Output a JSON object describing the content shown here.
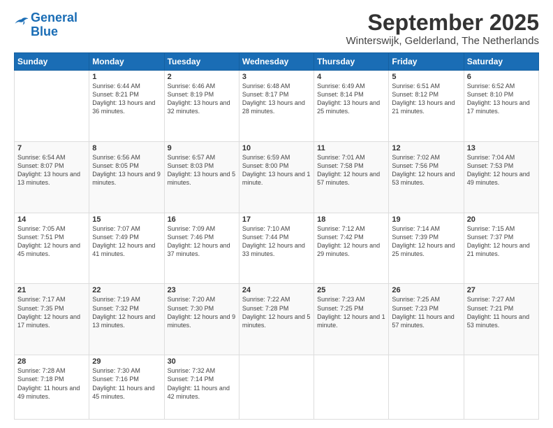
{
  "logo": {
    "line1": "General",
    "line2": "Blue"
  },
  "header": {
    "month": "September 2025",
    "location": "Winterswijk, Gelderland, The Netherlands"
  },
  "weekdays": [
    "Sunday",
    "Monday",
    "Tuesday",
    "Wednesday",
    "Thursday",
    "Friday",
    "Saturday"
  ],
  "weeks": [
    [
      {
        "day": "",
        "sunrise": "",
        "sunset": "",
        "daylight": ""
      },
      {
        "day": "1",
        "sunrise": "6:44 AM",
        "sunset": "8:21 PM",
        "daylight": "13 hours and 36 minutes."
      },
      {
        "day": "2",
        "sunrise": "6:46 AM",
        "sunset": "8:19 PM",
        "daylight": "13 hours and 32 minutes."
      },
      {
        "day": "3",
        "sunrise": "6:48 AM",
        "sunset": "8:17 PM",
        "daylight": "13 hours and 28 minutes."
      },
      {
        "day": "4",
        "sunrise": "6:49 AM",
        "sunset": "8:14 PM",
        "daylight": "13 hours and 25 minutes."
      },
      {
        "day": "5",
        "sunrise": "6:51 AM",
        "sunset": "8:12 PM",
        "daylight": "13 hours and 21 minutes."
      },
      {
        "day": "6",
        "sunrise": "6:52 AM",
        "sunset": "8:10 PM",
        "daylight": "13 hours and 17 minutes."
      }
    ],
    [
      {
        "day": "7",
        "sunrise": "6:54 AM",
        "sunset": "8:07 PM",
        "daylight": "13 hours and 13 minutes."
      },
      {
        "day": "8",
        "sunrise": "6:56 AM",
        "sunset": "8:05 PM",
        "daylight": "13 hours and 9 minutes."
      },
      {
        "day": "9",
        "sunrise": "6:57 AM",
        "sunset": "8:03 PM",
        "daylight": "13 hours and 5 minutes."
      },
      {
        "day": "10",
        "sunrise": "6:59 AM",
        "sunset": "8:00 PM",
        "daylight": "13 hours and 1 minute."
      },
      {
        "day": "11",
        "sunrise": "7:01 AM",
        "sunset": "7:58 PM",
        "daylight": "12 hours and 57 minutes."
      },
      {
        "day": "12",
        "sunrise": "7:02 AM",
        "sunset": "7:56 PM",
        "daylight": "12 hours and 53 minutes."
      },
      {
        "day": "13",
        "sunrise": "7:04 AM",
        "sunset": "7:53 PM",
        "daylight": "12 hours and 49 minutes."
      }
    ],
    [
      {
        "day": "14",
        "sunrise": "7:05 AM",
        "sunset": "7:51 PM",
        "daylight": "12 hours and 45 minutes."
      },
      {
        "day": "15",
        "sunrise": "7:07 AM",
        "sunset": "7:49 PM",
        "daylight": "12 hours and 41 minutes."
      },
      {
        "day": "16",
        "sunrise": "7:09 AM",
        "sunset": "7:46 PM",
        "daylight": "12 hours and 37 minutes."
      },
      {
        "day": "17",
        "sunrise": "7:10 AM",
        "sunset": "7:44 PM",
        "daylight": "12 hours and 33 minutes."
      },
      {
        "day": "18",
        "sunrise": "7:12 AM",
        "sunset": "7:42 PM",
        "daylight": "12 hours and 29 minutes."
      },
      {
        "day": "19",
        "sunrise": "7:14 AM",
        "sunset": "7:39 PM",
        "daylight": "12 hours and 25 minutes."
      },
      {
        "day": "20",
        "sunrise": "7:15 AM",
        "sunset": "7:37 PM",
        "daylight": "12 hours and 21 minutes."
      }
    ],
    [
      {
        "day": "21",
        "sunrise": "7:17 AM",
        "sunset": "7:35 PM",
        "daylight": "12 hours and 17 minutes."
      },
      {
        "day": "22",
        "sunrise": "7:19 AM",
        "sunset": "7:32 PM",
        "daylight": "12 hours and 13 minutes."
      },
      {
        "day": "23",
        "sunrise": "7:20 AM",
        "sunset": "7:30 PM",
        "daylight": "12 hours and 9 minutes."
      },
      {
        "day": "24",
        "sunrise": "7:22 AM",
        "sunset": "7:28 PM",
        "daylight": "12 hours and 5 minutes."
      },
      {
        "day": "25",
        "sunrise": "7:23 AM",
        "sunset": "7:25 PM",
        "daylight": "12 hours and 1 minute."
      },
      {
        "day": "26",
        "sunrise": "7:25 AM",
        "sunset": "7:23 PM",
        "daylight": "11 hours and 57 minutes."
      },
      {
        "day": "27",
        "sunrise": "7:27 AM",
        "sunset": "7:21 PM",
        "daylight": "11 hours and 53 minutes."
      }
    ],
    [
      {
        "day": "28",
        "sunrise": "7:28 AM",
        "sunset": "7:18 PM",
        "daylight": "11 hours and 49 minutes."
      },
      {
        "day": "29",
        "sunrise": "7:30 AM",
        "sunset": "7:16 PM",
        "daylight": "11 hours and 45 minutes."
      },
      {
        "day": "30",
        "sunrise": "7:32 AM",
        "sunset": "7:14 PM",
        "daylight": "11 hours and 42 minutes."
      },
      {
        "day": "",
        "sunrise": "",
        "sunset": "",
        "daylight": ""
      },
      {
        "day": "",
        "sunrise": "",
        "sunset": "",
        "daylight": ""
      },
      {
        "day": "",
        "sunrise": "",
        "sunset": "",
        "daylight": ""
      },
      {
        "day": "",
        "sunrise": "",
        "sunset": "",
        "daylight": ""
      }
    ]
  ]
}
